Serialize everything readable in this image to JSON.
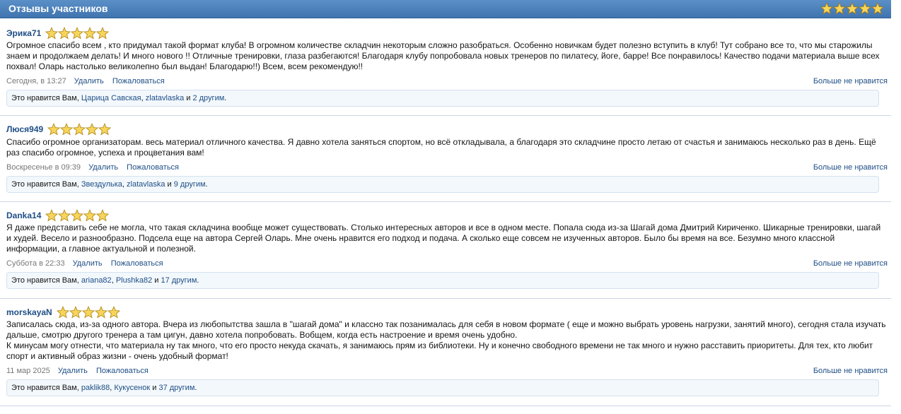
{
  "header": {
    "title": "Отзывы участников",
    "rating_stars": 5
  },
  "reviews": [
    {
      "username": "Эрика71",
      "stars": 5,
      "text": "Огромное спасибо всем , кто придумал такой формат клуба! В огромном количестве складчин некоторым сложно разобраться. Особенно новичкам будет полезно вступить в клуб! Тут собрано все то, что мы старожилы знаем и продолжаем делать! И много нового !! Отличные тренировки, глаза разбегаются! Благодаря клубу попробовала новых тренеров по пилатесу, йоге, барре! Все понравилось! Качество подачи материала выше всех похвал! Оларь настолько великолепно был выдан! Благодарю!!) Всем, всем рекомендую!!",
      "date": "Сегодня, в 13:27",
      "delete_label": "Удалить",
      "report_label": "Пожаловаться",
      "unlike_label": "Больше не нравится",
      "likes_prefix": "Это нравится Вам,",
      "liker1": "Царица Савская",
      "sep": ",",
      "liker2": "zlatavlaska",
      "and_word": "и",
      "others": "2 другим",
      "end": "."
    },
    {
      "username": "Люся949",
      "stars": 5,
      "text": "Спасибо огромное организаторам. весь материал отличного качества. Я давно хотела заняться спортом, но всё откладывала, а благодаря это складчине просто летаю от счастья и занимаюсь несколько раз в день. Ещё раз спасибо огромное, успеха и процветания вам!",
      "date": "Воскресенье в 09:39",
      "delete_label": "Удалить",
      "report_label": "Пожаловаться",
      "unlike_label": "Больше не нравится",
      "likes_prefix": "Это нравится Вам,",
      "liker1": "Звездулька",
      "sep": ",",
      "liker2": "zlatavlaska",
      "and_word": "и",
      "others": "9 другим",
      "end": "."
    },
    {
      "username": "Danka14",
      "stars": 5,
      "text": "Я даже представить себе не могла, что такая складчина вообще может существовать. Столько интересных авторов и все в одном месте. Попала сюда из-за Шагай дома Дмитрий Кириченко. Шикарные тренировки, шагай и худей. Весело и разнообразно. Подсела еще на автора Сергей Оларь. Мне очень нравится его подход и подача. А сколько еще совсем не изученных авторов. Было бы время на все. Безумно много классной информации, а главное актуальной и полезной.",
      "date": "Суббота в 22:33",
      "delete_label": "Удалить",
      "report_label": "Пожаловаться",
      "unlike_label": "Больше не нравится",
      "likes_prefix": "Это нравится Вам,",
      "liker1": "ariana82",
      "sep": ",",
      "liker2": "Plushka82",
      "and_word": "и",
      "others": "17 другим",
      "end": "."
    },
    {
      "username": "morskayaN",
      "stars": 5,
      "text": "Записалась сюда, из-за одного автора. Вчера из любопытства зашла в \"шагай дома\" и классно так позанималась для себя в новом формате ( еще и можно выбрать уровень нагрузки, занятий много), сегодня стала изучать дальше, смотрю другого тренера а там цигун, давно хотела попробовать. Вобщем, когда есть настроение и время очень удобно.\nК минусам могу отнести, что материала ну так много, что его просто некуда скачать, я занимаюсь прям из библиотеки. Ну и конечно свободного времени не так много и нужно расставить приоритеты. Для тех, кто любит спорт и активный образ жизни - очень удобный формат!",
      "date": "11 мар 2025",
      "delete_label": "Удалить",
      "report_label": "Пожаловаться",
      "unlike_label": "Больше не нравится",
      "likes_prefix": "Это нравится Вам,",
      "liker1": "paklik88",
      "sep": ",",
      "liker2": "Кукусенок",
      "and_word": "и",
      "others": "37 другим",
      "end": "."
    }
  ],
  "colors": {
    "header_bg": "#4a80bd",
    "link": "#1e4e86",
    "star_fill": "#f7d55a",
    "star_stroke": "#b48a1c"
  }
}
